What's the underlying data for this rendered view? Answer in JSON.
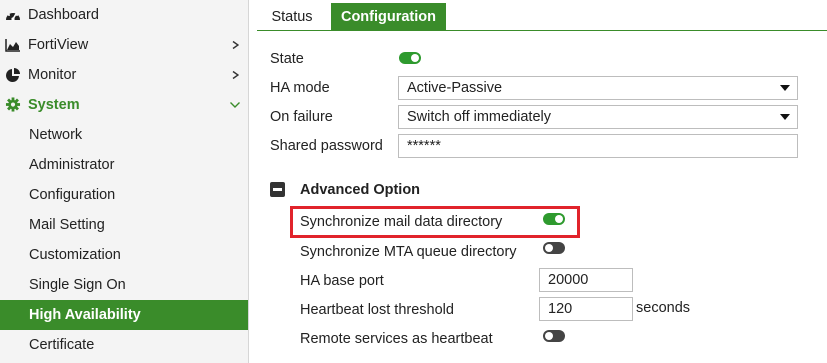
{
  "sidebar": {
    "items": [
      {
        "label": "Dashboard",
        "icon": "dashboard-icon"
      },
      {
        "label": "FortiView",
        "icon": "chart-icon"
      },
      {
        "label": "Monitor",
        "icon": "pie-chart-icon"
      },
      {
        "label": "System",
        "icon": "gear-icon"
      }
    ],
    "sub_items": [
      {
        "label": "Network"
      },
      {
        "label": "Administrator"
      },
      {
        "label": "Configuration"
      },
      {
        "label": "Mail Setting"
      },
      {
        "label": "Customization"
      },
      {
        "label": "Single Sign On"
      },
      {
        "label": "High Availability"
      },
      {
        "label": "Certificate"
      }
    ]
  },
  "tabs": [
    {
      "label": "Status"
    },
    {
      "label": "Configuration"
    }
  ],
  "form": {
    "state_label": "State",
    "state_on": true,
    "ha_mode_label": "HA mode",
    "ha_mode_value": "Active-Passive",
    "on_failure_label": "On failure",
    "on_failure_value": "Switch off immediately",
    "shared_password_label": "Shared password",
    "shared_password_value": "******"
  },
  "advanced": {
    "title": "Advanced Option",
    "sync_mail_label": "Synchronize mail data directory",
    "sync_mail_on": true,
    "sync_mta_label": "Synchronize MTA queue directory",
    "sync_mta_on": false,
    "base_port_label": "HA base port",
    "base_port_value": "20000",
    "heartbeat_label": "Heartbeat lost threshold",
    "heartbeat_value": "120",
    "heartbeat_unit": "seconds",
    "remote_label": "Remote services as heartbeat",
    "remote_on": false
  },
  "colors": {
    "accent": "#3a8c2a",
    "highlight": "#e1232b"
  }
}
